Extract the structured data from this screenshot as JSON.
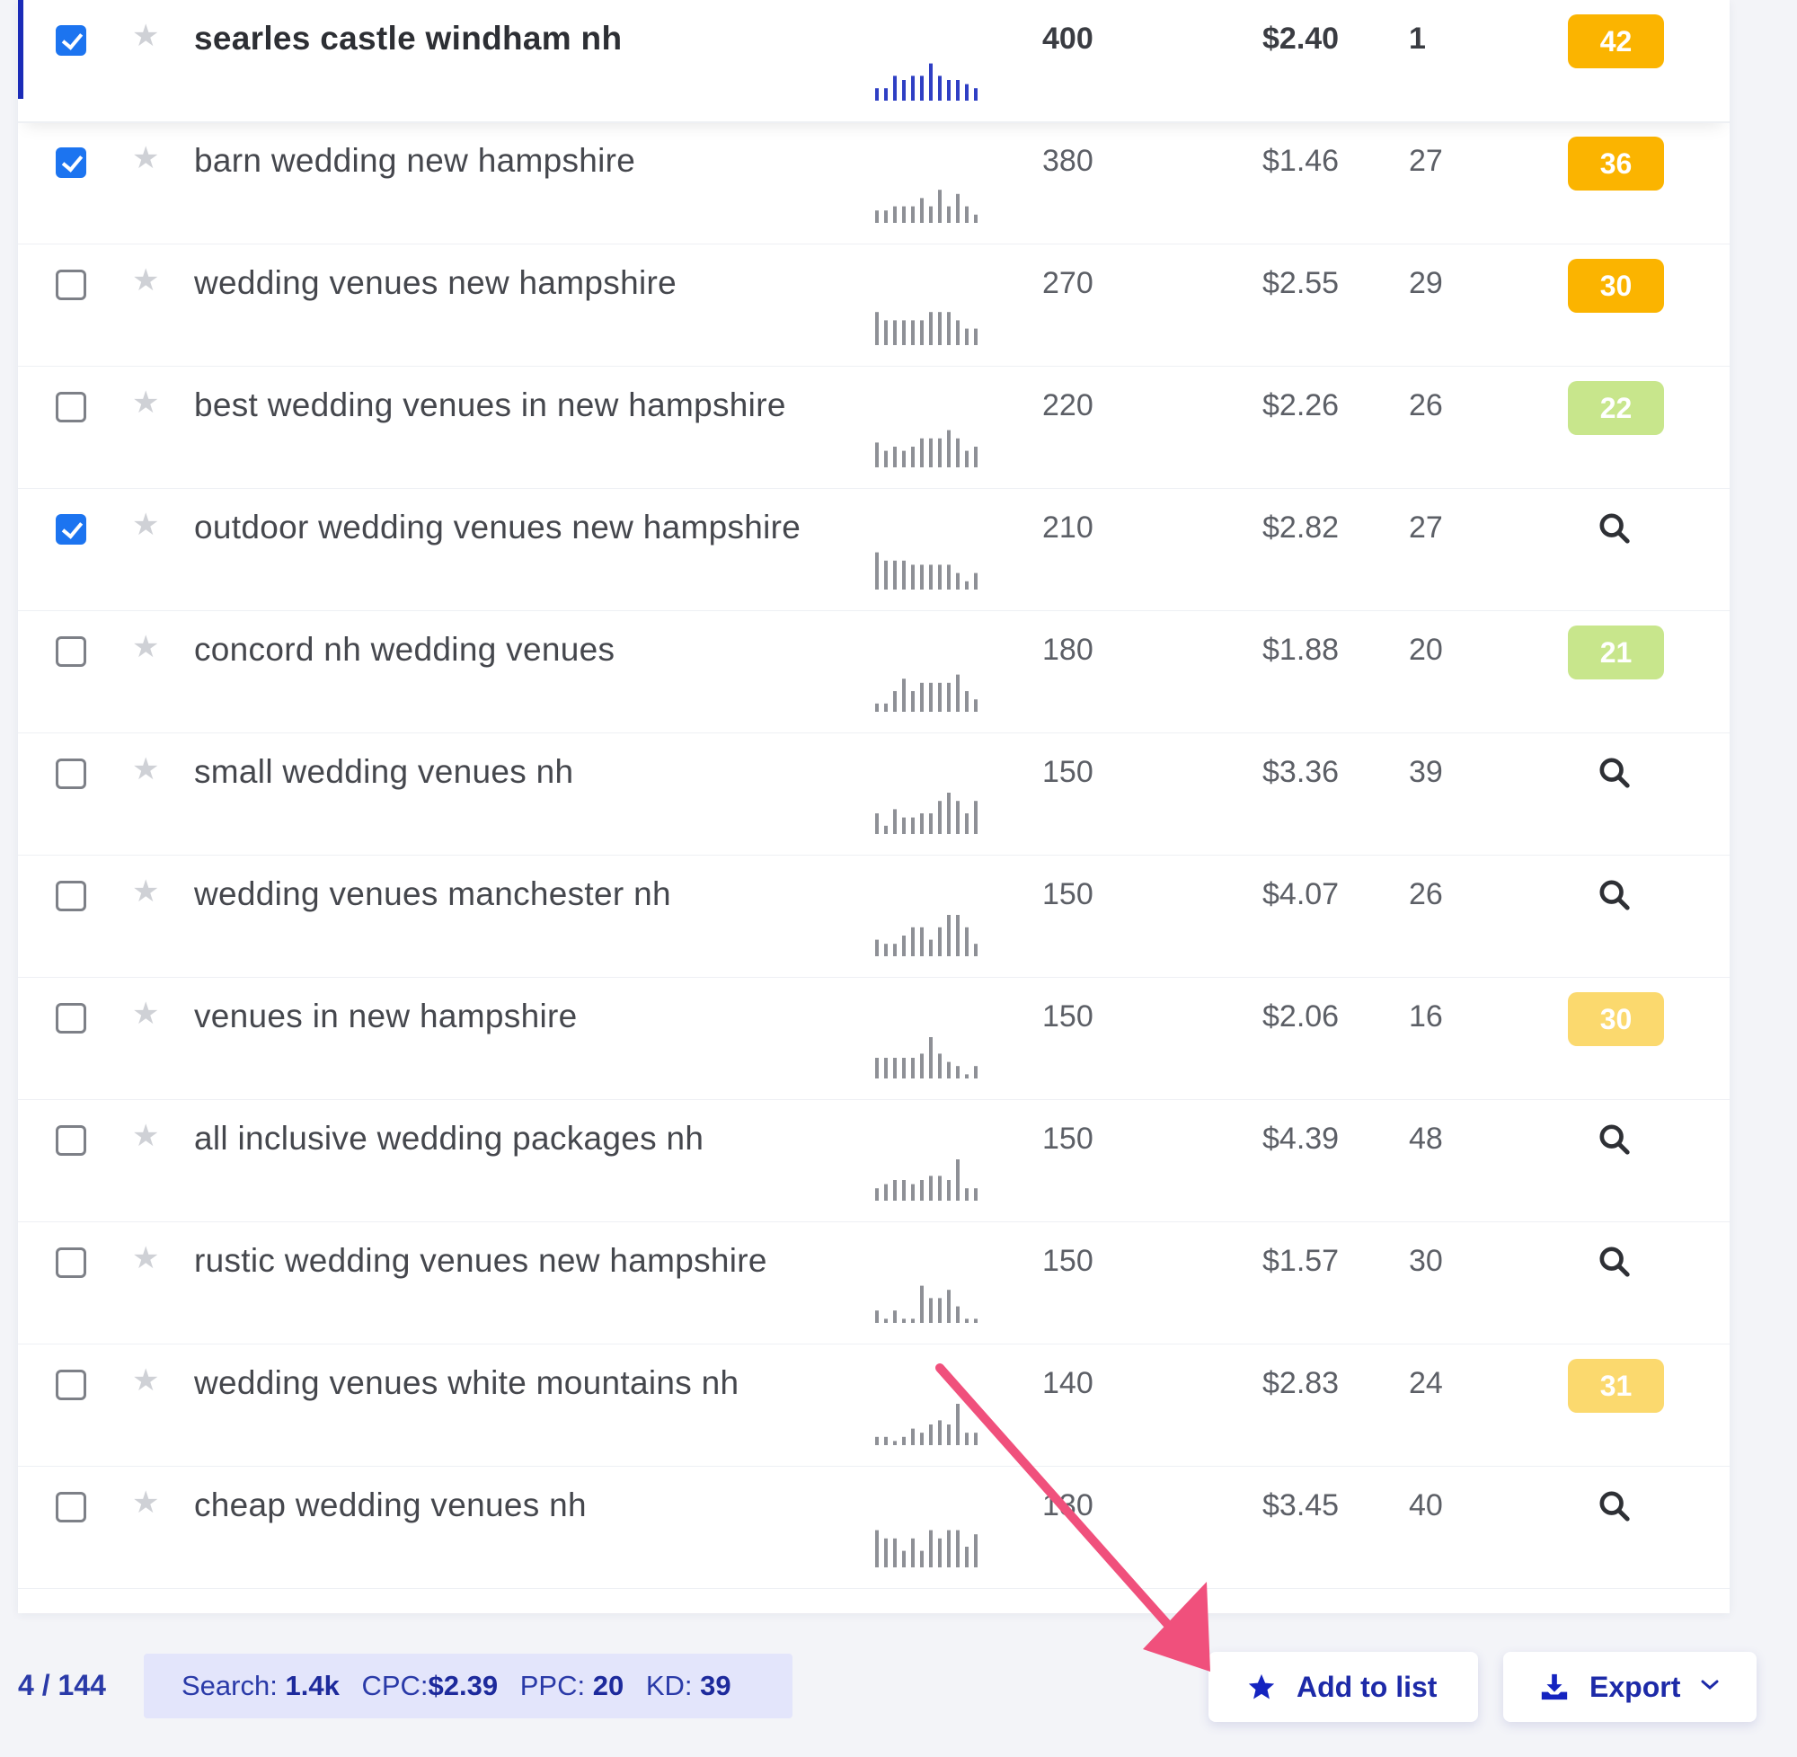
{
  "colors": {
    "accent": "#1a2bb8",
    "checkbox_checked": "#1c74f0",
    "kd_orange": "#fbb400",
    "kd_yellow": "#fbd96e",
    "kd_green": "#c8e68c",
    "trend_active": "#2f3fc4",
    "trend_default": "#8e9096",
    "annotation_arrow": "#f0507c"
  },
  "rows": [
    {
      "keyword": "searles castle windham nh",
      "checked": true,
      "active": true,
      "volume": "400",
      "cpc": "$2.40",
      "ppc": "1",
      "kd": "42",
      "kd_color": "orange",
      "trend": [
        3,
        3,
        6,
        5,
        6,
        6,
        9,
        6,
        5,
        5,
        4,
        3
      ]
    },
    {
      "keyword": "barn wedding new hampshire",
      "checked": true,
      "active": false,
      "volume": "380",
      "cpc": "$1.46",
      "ppc": "27",
      "kd": "36",
      "kd_color": "orange",
      "trend": [
        3,
        3,
        4,
        4,
        4,
        6,
        4,
        8,
        4,
        7,
        4,
        2
      ]
    },
    {
      "keyword": "wedding venues new hampshire",
      "checked": false,
      "active": false,
      "volume": "270",
      "cpc": "$2.55",
      "ppc": "29",
      "kd": "30",
      "kd_color": "orange",
      "trend": [
        8,
        6,
        6,
        6,
        6,
        6,
        8,
        8,
        8,
        6,
        4,
        4
      ]
    },
    {
      "keyword": "best wedding venues in new hampshire",
      "checked": false,
      "active": false,
      "volume": "220",
      "cpc": "$2.26",
      "ppc": "26",
      "kd": "22",
      "kd_color": "green",
      "trend": [
        6,
        4,
        5,
        4,
        5,
        7,
        7,
        7,
        9,
        7,
        4,
        5
      ]
    },
    {
      "keyword": "outdoor wedding venues new hampshire",
      "checked": true,
      "active": false,
      "volume": "210",
      "cpc": "$2.82",
      "ppc": "27",
      "kd": null,
      "kd_color": "search",
      "trend": [
        9,
        7,
        7,
        7,
        6,
        6,
        6,
        6,
        6,
        4,
        2,
        4
      ]
    },
    {
      "keyword": "concord nh wedding venues",
      "checked": false,
      "active": false,
      "volume": "180",
      "cpc": "$1.88",
      "ppc": "20",
      "kd": "21",
      "kd_color": "green",
      "trend": [
        2,
        2,
        5,
        8,
        5,
        7,
        7,
        7,
        7,
        9,
        5,
        3
      ]
    },
    {
      "keyword": "small wedding venues nh",
      "checked": false,
      "active": false,
      "volume": "150",
      "cpc": "$3.36",
      "ppc": "39",
      "kd": null,
      "kd_color": "search",
      "trend": [
        5,
        2,
        6,
        4,
        4,
        5,
        5,
        8,
        10,
        8,
        5,
        8
      ]
    },
    {
      "keyword": "wedding venues manchester nh",
      "checked": false,
      "active": false,
      "volume": "150",
      "cpc": "$4.07",
      "ppc": "26",
      "kd": null,
      "kd_color": "search",
      "trend": [
        4,
        3,
        3,
        5,
        7,
        7,
        4,
        7,
        10,
        10,
        7,
        3
      ]
    },
    {
      "keyword": "venues in new hampshire",
      "checked": false,
      "active": false,
      "volume": "150",
      "cpc": "$2.06",
      "ppc": "16",
      "kd": "30",
      "kd_color": "yellow",
      "trend": [
        5,
        5,
        5,
        5,
        5,
        6,
        10,
        6,
        4,
        3,
        1,
        3
      ]
    },
    {
      "keyword": "all inclusive wedding packages nh",
      "checked": false,
      "active": false,
      "volume": "150",
      "cpc": "$4.39",
      "ppc": "48",
      "kd": null,
      "kd_color": "search",
      "trend": [
        3,
        4,
        5,
        5,
        4,
        5,
        6,
        6,
        5,
        10,
        3,
        3
      ]
    },
    {
      "keyword": "rustic wedding venues new hampshire",
      "checked": false,
      "active": false,
      "volume": "150",
      "cpc": "$1.57",
      "ppc": "30",
      "kd": null,
      "kd_color": "search",
      "trend": [
        3,
        1,
        3,
        1,
        1,
        9,
        6,
        6,
        8,
        4,
        1,
        1
      ]
    },
    {
      "keyword": "wedding venues white mountains nh",
      "checked": false,
      "active": false,
      "volume": "140",
      "cpc": "$2.83",
      "ppc": "24",
      "kd": "31",
      "kd_color": "yellow",
      "trend": [
        2,
        2,
        1,
        2,
        4,
        3,
        5,
        6,
        5,
        10,
        3,
        3
      ]
    },
    {
      "keyword": "cheap wedding venues nh",
      "checked": false,
      "active": false,
      "volume": "130",
      "cpc": "$3.45",
      "ppc": "40",
      "kd": null,
      "kd_color": "search",
      "trend": [
        9,
        7,
        7,
        4,
        7,
        4,
        9,
        7,
        9,
        9,
        5,
        8
      ]
    }
  ],
  "footer": {
    "count": "4 / 144",
    "summary": {
      "search_label": "Search:",
      "search_value": "1.4k",
      "cpc_label": "CPC:",
      "cpc_value": "$2.39",
      "ppc_label": "PPC:",
      "ppc_value": "20",
      "kd_label": "KD:",
      "kd_value": "39"
    },
    "add_to_list_label": "Add to list",
    "export_label": "Export"
  },
  "icons": {
    "star": "star-icon",
    "search": "search-icon",
    "download": "download-icon",
    "chevron": "chevron-down-icon"
  }
}
